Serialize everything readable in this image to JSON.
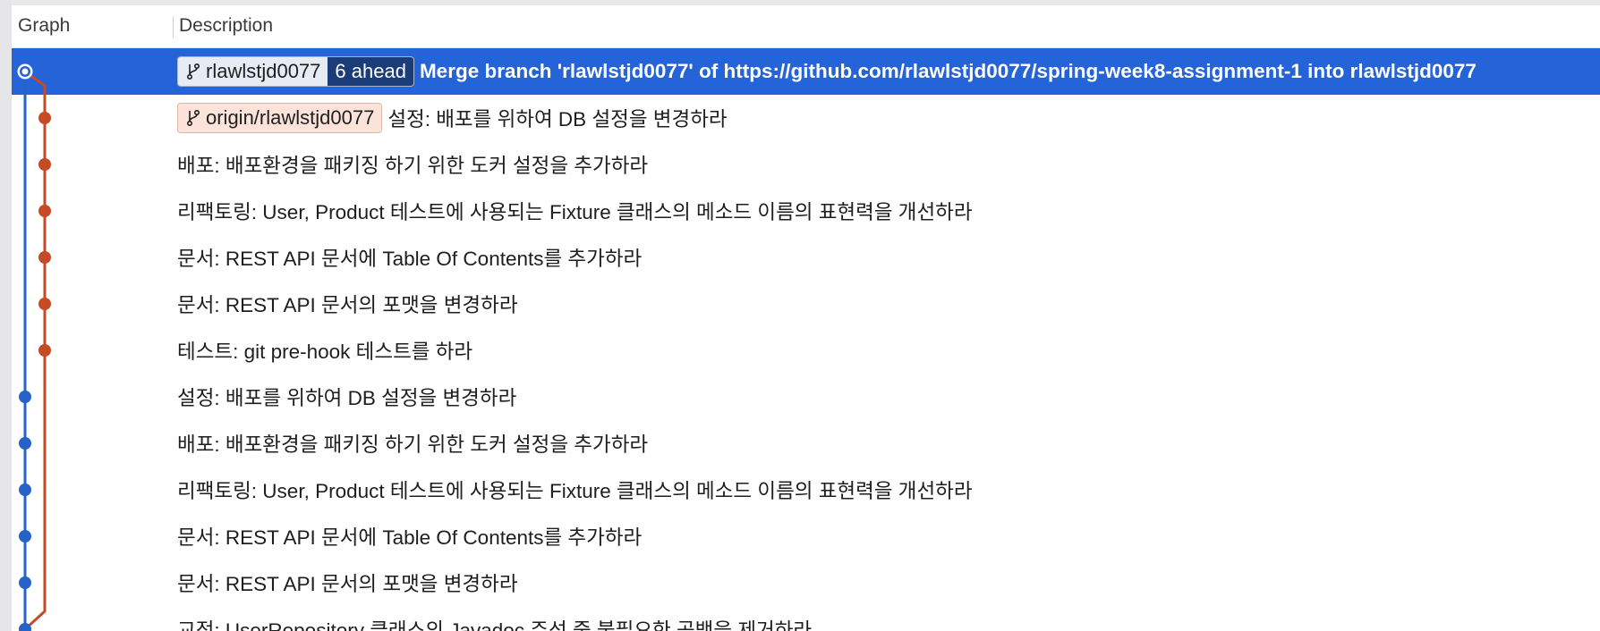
{
  "header": {
    "graph_label": "Graph",
    "description_label": "Description"
  },
  "colors": {
    "selected_row": "#2563d9",
    "blue_lane": "#2563c9",
    "orange_lane": "#c64a23",
    "local_badge_bg": "#e7ebf3",
    "ahead_badge_bg": "#1a3c78",
    "remote_badge_bg": "#fbe3da"
  },
  "icons": {
    "branch_badge_icon": "branch-icon"
  },
  "commits": [
    {
      "lane": "blue",
      "selected": true,
      "merge": true,
      "local_branch": "rlawlstjd0077",
      "ahead": "6 ahead",
      "message": "Merge branch 'rlawlstjd0077' of https://github.com/rlawlstjd0077/spring-week8-assignment-1 into rlawlstjd0077"
    },
    {
      "lane": "orange",
      "remote_branch": "origin/rlawlstjd0077",
      "message": "설정: 배포를 위하여 DB 설정을 변경하라"
    },
    {
      "lane": "orange",
      "message": "배포: 배포환경을 패키징 하기 위한 도커 설정을 추가하라"
    },
    {
      "lane": "orange",
      "message": "리팩토링: User, Product 테스트에 사용되는 Fixture 클래스의 메소드 이름의 표현력을 개선하라"
    },
    {
      "lane": "orange",
      "message": "문서: REST API 문서에 Table Of Contents를 추가하라"
    },
    {
      "lane": "orange",
      "message": "문서: REST API 문서의 포맷을 변경하라"
    },
    {
      "lane": "orange",
      "message": "테스트: git pre-hook 테스트를 하라"
    },
    {
      "lane": "blue",
      "message": "설정: 배포를 위하여 DB 설정을 변경하라"
    },
    {
      "lane": "blue",
      "message": "배포: 배포환경을 패키징 하기 위한 도커 설정을 추가하라"
    },
    {
      "lane": "blue",
      "message": "리팩토링: User, Product 테스트에 사용되는 Fixture 클래스의 메소드 이름의 표현력을 개선하라"
    },
    {
      "lane": "blue",
      "message": "문서: REST API 문서에 Table Of Contents를 추가하라"
    },
    {
      "lane": "blue",
      "message": "문서: REST API 문서의 포맷을 변경하라"
    },
    {
      "lane": "blue",
      "message": "교정: UserRepository 클래스의 Javadoc 주석 중 불필요한 공백을 제거하라"
    }
  ]
}
